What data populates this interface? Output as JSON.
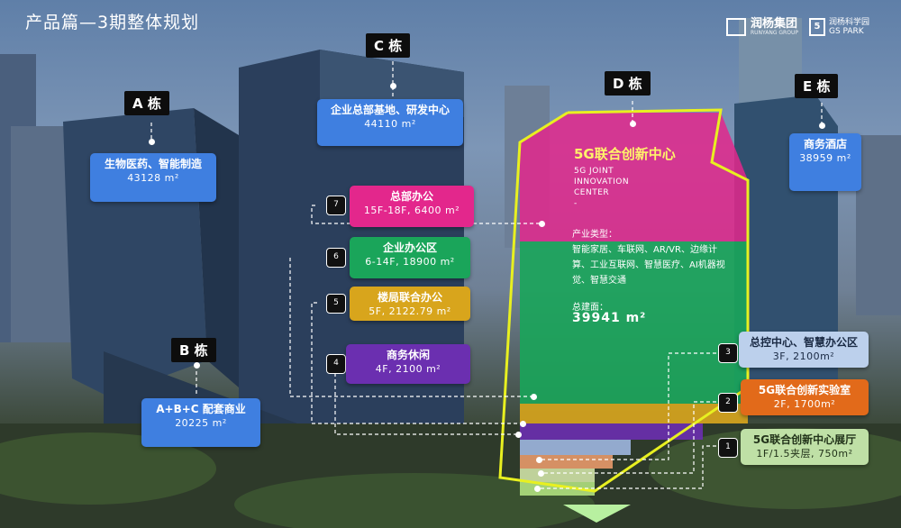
{
  "title": "产品篇—3期整体规划",
  "logos": {
    "brand1_name": "润杨集团",
    "brand1_sub": "RUNYANG GROUP",
    "brand2_name": "润杨科学园",
    "brand2_sub": "GS PARK"
  },
  "buildings": {
    "a": {
      "tag": "A 栋",
      "use": "生物医药、智能制造",
      "area": "43128 m²"
    },
    "b": {
      "tag": "B 栋",
      "use": "A+B+C 配套商业",
      "area": "20225 m²"
    },
    "c": {
      "tag": "C 栋",
      "use": "企业总部基地、研发中心",
      "area": "44110 m²"
    },
    "d": {
      "tag": "D 栋"
    },
    "e": {
      "tag": "E 栋",
      "use": "商务酒店",
      "area": "38959 m²"
    }
  },
  "d_center": {
    "name": "5G联合创新中心",
    "name_en": "5G JOINT\nINNOVATION\nCENTER\n-",
    "types_label": "产业类型：",
    "types": "智能家居、车联网、AR/VR、边缘计算、工业互联网、智慧医疗、AI机器视觉、智慧交通",
    "area_label": "总建面：",
    "area": "39941 m²"
  },
  "floors_left": [
    {
      "tag": "7",
      "title": "总部办公",
      "detail": "15F-18F, 6400 m²",
      "color": "pink"
    },
    {
      "tag": "6",
      "title": "企业办公区",
      "detail": "6-14F, 18900 m²",
      "color": "green"
    },
    {
      "tag": "5",
      "title": "楼局联合办公",
      "detail": "5F, 2122.79 m²",
      "color": "gold"
    },
    {
      "tag": "4",
      "title": "商务休闲",
      "detail": "4F, 2100 m²",
      "color": "purple"
    }
  ],
  "floors_right": [
    {
      "tag": "3",
      "title": "总控中心、智慧办公区",
      "detail": "3F, 2100m²",
      "color": "lblue"
    },
    {
      "tag": "2",
      "title": "5G联合创新实验室",
      "detail": "2F, 1700m²",
      "color": "orange"
    },
    {
      "tag": "1",
      "title": "5G联合创新中心展厅",
      "detail": "1F/1.5夹层, 750m²",
      "color": "lgreen"
    }
  ],
  "colors": {
    "pink": "#e3278c",
    "green": "#1aa55a",
    "gold": "#d8a51c",
    "purple": "#6b2fb0",
    "lblue": "#bcd0ec",
    "orange": "#e26a1a",
    "lgreen": "#bfe0a6",
    "outline": "#e8f020"
  }
}
